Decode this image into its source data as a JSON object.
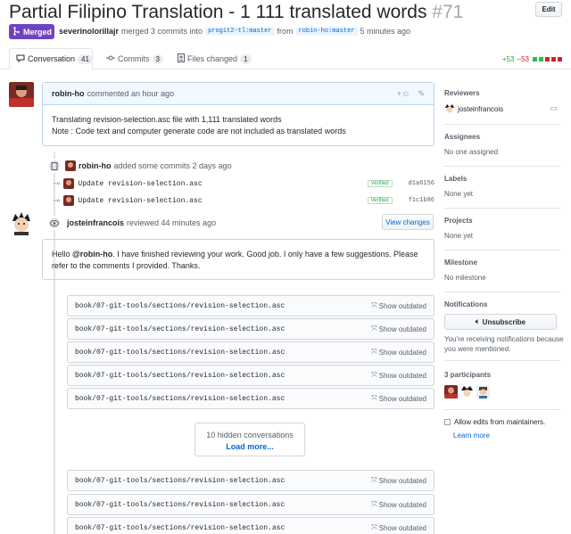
{
  "pr": {
    "title": "Partial Filipino Translation - 1 111 translated words",
    "number": "#71",
    "edit_label": "Edit",
    "state_label": "Merged",
    "author": "severinolorillajr",
    "merge_text": "merged 3 commits into",
    "base_branch": "progit2-tl:master",
    "from_text": "from",
    "head_branch": "robin-ho:master",
    "time": "5 minutes ago"
  },
  "tabs": [
    {
      "label": "Conversation",
      "count": "41",
      "icon": "comment-icon"
    },
    {
      "label": "Commits",
      "count": "3",
      "icon": "commit-icon"
    },
    {
      "label": "Files changed",
      "count": "1",
      "icon": "file-diff-icon"
    }
  ],
  "diffstat": {
    "additions": "+53",
    "deletions": "−53"
  },
  "comment": {
    "author": "robin-ho",
    "action": "commented an hour ago",
    "line1": "Translating revision-selection.asc file with 1,111 translated words",
    "line2": "Note : Code text and computer generate code are not included as translated words"
  },
  "commits_event": {
    "author": "robin-ho",
    "action": "added some commits 2 days ago",
    "commits": [
      {
        "message": "Update revision-selection.asc",
        "badge": "Verified",
        "sha": "d1a6156"
      },
      {
        "message": "Update revision-selection.asc",
        "badge": "Verified",
        "sha": "f1c1b86"
      }
    ]
  },
  "review": {
    "author": "josteinfrancois",
    "action": "reviewed 44 minutes ago",
    "view_changes_label": "View changes",
    "body_prefix": "Hello ",
    "mention": "@robin-ho",
    "body_rest": ". I have finished reviewing your work. Good job. I only have a few suggestions. Please refer to the comments I provided. Thanks."
  },
  "files": {
    "path": "book/07-git-tools/sections/revision-selection.asc",
    "show_outdated_label": "Show outdated"
  },
  "hidden": {
    "count_text": "10 hidden conversations",
    "load_more": "Load more..."
  },
  "sidebar": {
    "reviewers_head": "Reviewers",
    "reviewer_name": "josteinfrancois",
    "assignees_head": "Assignees",
    "assignees_text": "No one assigned",
    "labels_head": "Labels",
    "labels_text": "None yet",
    "projects_head": "Projects",
    "projects_text": "None yet",
    "milestone_head": "Milestone",
    "milestone_text": "No milestone",
    "notifications_head": "Notifications",
    "unsubscribe_label": "Unsubscribe",
    "notif_line1": "You’re receiving notifications because",
    "notif_line2": "you were mentioned.",
    "participants_head": "3 participants",
    "allow_edits_label": "Allow edits from maintainers.",
    "learn_more": "Learn more"
  },
  "colors": {
    "merged": "#6f42c1",
    "link": "#0366d6",
    "add": "#28a745",
    "del": "#cb2431"
  }
}
